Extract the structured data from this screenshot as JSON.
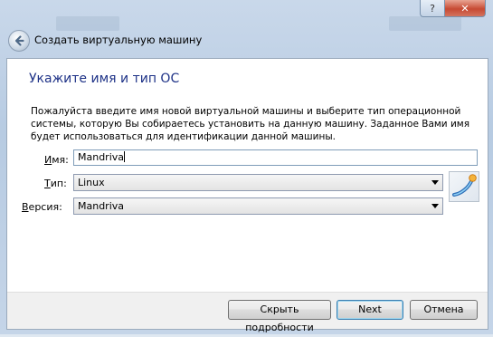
{
  "window": {
    "title": "Создать виртуальную машину",
    "help_label": "?",
    "close_label": "✕"
  },
  "page": {
    "heading": "Укажите имя и тип ОС",
    "description": "Пожалуйста введите имя новой виртуальной машины и выберите тип операционной системы, которую Вы собираетесь установить на данную машину. Заданное Вами имя будет использоваться для идентификации данной машины."
  },
  "form": {
    "name_label_prefix": "",
    "name_label_underlined": "И",
    "name_label_suffix": "мя:",
    "name_value": "Mandriva",
    "type_label_prefix": "",
    "type_label_underlined": "Т",
    "type_label_suffix": "ип:",
    "type_value": "Linux",
    "version_label_prefix": "",
    "version_label_underlined": "В",
    "version_label_suffix": "ерсия:",
    "version_value": "Mandriva"
  },
  "buttons": {
    "details": "Скрыть подробности",
    "next": "Next",
    "cancel": "Отмена"
  },
  "icons": {
    "back": "back-arrow-icon",
    "os_type": "mandriva-linux-icon"
  },
  "colors": {
    "heading": "#1e3287",
    "close_button": "#c74a33"
  }
}
